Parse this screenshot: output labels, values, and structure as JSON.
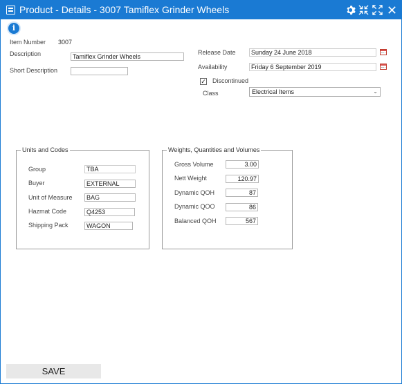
{
  "window": {
    "title": "Product - Details - 3007 Tamiflex Grinder Wheels",
    "icons": [
      "app-icon",
      "gear-icon",
      "collapse-icon",
      "expand-icon"
    ]
  },
  "item": {
    "item_number_label": "Item Number",
    "item_number": "3007",
    "description_label": "Description",
    "description": "Tamiflex Grinder Wheels",
    "short_description_label": "Short Description",
    "short_description": "",
    "release_date_label": "Release Date",
    "release_date": "Sunday 24 June 2018",
    "availability_label": "Availability",
    "availability": "Friday 6 September 2019",
    "discontinued_label": "Discontinued",
    "discontinued_mark": "✓",
    "class_label": "Class",
    "class_value": "Electrical Items"
  },
  "units_and_codes": {
    "legend": "Units and Codes",
    "rows": [
      {
        "label": "Group",
        "value": "TBA"
      },
      {
        "label": "Buyer",
        "value": "EXTERNAL"
      },
      {
        "label": "Unit of Measure",
        "value": "BAG"
      },
      {
        "label": "Hazmat Code",
        "value": "Q4253"
      },
      {
        "label": "Shipping Pack",
        "value": "WAGON"
      }
    ]
  },
  "weights": {
    "legend": "Weights, Quantities and Volumes",
    "rows": [
      {
        "label": "Gross Volume",
        "value": "3.00"
      },
      {
        "label": "Nett Weight",
        "value": "120.97"
      },
      {
        "label": "Dynamic QOH",
        "value": "87"
      },
      {
        "label": "Dynamic QOO",
        "value": "86"
      },
      {
        "label": "Balanced QOH",
        "value": "567"
      }
    ]
  },
  "actions": {
    "save_label": "SAVE"
  }
}
